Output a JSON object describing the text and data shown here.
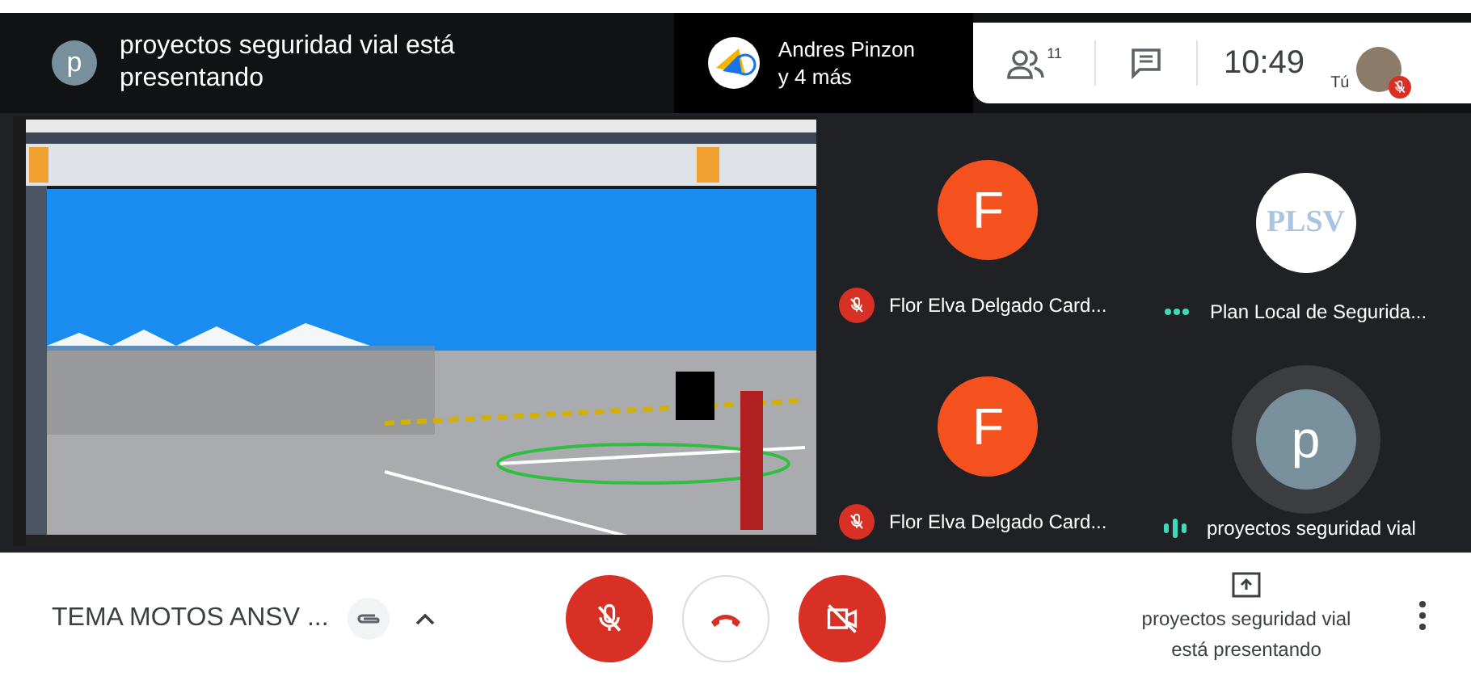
{
  "top_bar": {
    "presenter_avatar": "p",
    "presenter_text": "proyectos seguridad vial está presentando",
    "others": {
      "name": "Andres Pinzon",
      "more": "y 4 más"
    },
    "participant_count": "11",
    "time": "10:49",
    "self_label": "Tú",
    "self_muted": true
  },
  "tiles": [
    {
      "avatar": "F",
      "kind": "letter",
      "color": "#f4511e",
      "name": "Flor Elva Delgado Card...",
      "muted": true,
      "speaking": false
    },
    {
      "avatar": "PLSV",
      "kind": "logo",
      "color": "#ffffff",
      "name": "Plan Local de Segurida...",
      "muted": false,
      "speaking": false
    },
    {
      "avatar": "F",
      "kind": "letter",
      "color": "#f4511e",
      "name": "Flor Elva Delgado Card...",
      "muted": true,
      "speaking": false
    },
    {
      "avatar": "p",
      "kind": "letter",
      "color": "#78909c",
      "name": "proyectos seguridad vial",
      "muted": false,
      "speaking": true
    }
  ],
  "bottom_bar": {
    "meeting_title": "TEMA MOTOS ANSV ...",
    "mic_on": false,
    "camera_on": false,
    "presenting_text": "proyectos seguridad vial está presentando"
  }
}
